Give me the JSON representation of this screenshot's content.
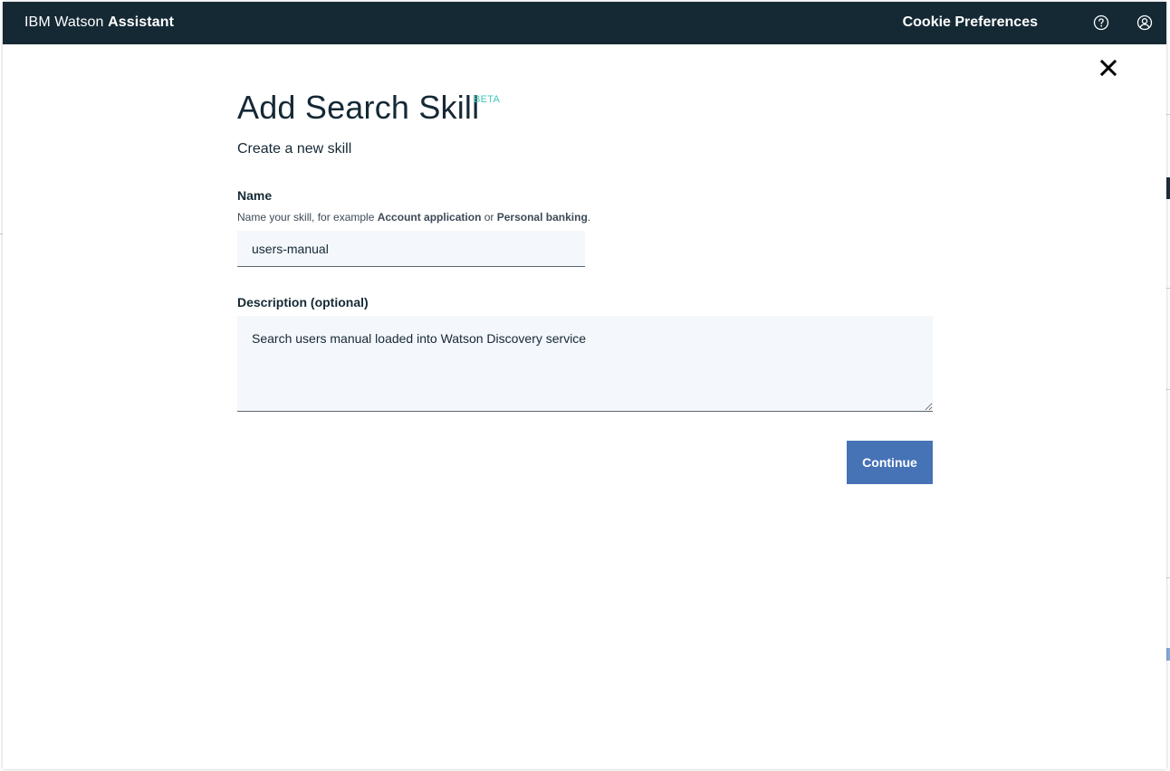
{
  "header": {
    "brand_light": "IBM Watson ",
    "brand_bold": "Assistant",
    "cookie_preferences": "Cookie Preferences",
    "help_icon": "help-icon",
    "user_icon": "user-icon"
  },
  "modal": {
    "title": "Add Search Skill",
    "badge": "BETA",
    "subtitle": "Create a new skill",
    "name": {
      "label": "Name",
      "helper_prefix": "Name your skill, for example ",
      "helper_example_1": "Account application",
      "helper_mid": " or ",
      "helper_example_2": "Personal banking",
      "helper_suffix": ".",
      "value": "users-manual"
    },
    "description": {
      "label": "Description (optional)",
      "value": "Search users manual loaded into Watson Discovery service"
    },
    "continue_label": "Continue",
    "close_icon": "close-icon"
  },
  "colors": {
    "header_bg": "#152935",
    "accent_beta": "#3ec7b5",
    "button_primary": "#4672b6",
    "field_bg": "#f4f7fb"
  }
}
